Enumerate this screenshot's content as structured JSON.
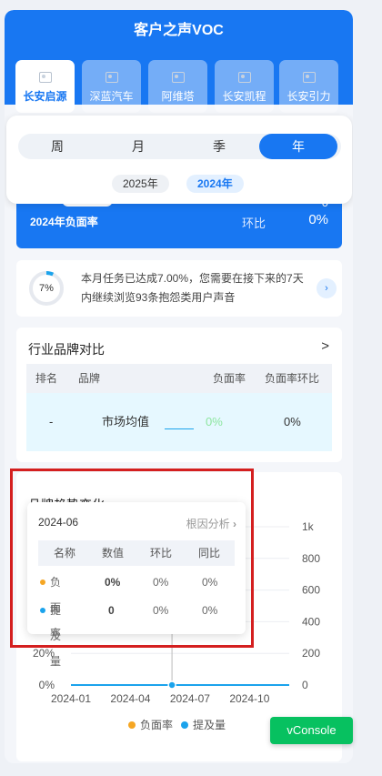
{
  "header": {
    "title": "客户之声VOC"
  },
  "brands": [
    {
      "label": "长安启源",
      "active": true
    },
    {
      "label": "深蓝汽车",
      "active": false
    },
    {
      "label": "阿维塔",
      "active": false
    },
    {
      "label": "长安凯程",
      "active": false
    },
    {
      "label": "长安引力",
      "active": false
    }
  ],
  "periods": [
    {
      "label": "周",
      "active": false
    },
    {
      "label": "月",
      "active": false
    },
    {
      "label": "季",
      "active": false
    },
    {
      "label": "年",
      "active": true
    }
  ],
  "years": [
    {
      "label": "2025年",
      "active": false
    },
    {
      "label": "2024年",
      "active": true
    }
  ],
  "summary": {
    "year_label": "2024年负面率",
    "huanbi_label": "环比",
    "huanbi_value": "0%",
    "top_value": "0"
  },
  "task": {
    "percent_text": "7%",
    "percent_value": 0.07,
    "message": "本月任务已达成7.00%，您需要在接下来的7天内继续浏览93条抱怨类用户声音",
    "arrow": "›"
  },
  "comparison": {
    "title": "行业品牌对比",
    "chevron": ">",
    "headers": [
      "排名",
      "品牌",
      "负面率",
      "负面率环比"
    ],
    "row": {
      "rank": "-",
      "brand": "市场均值",
      "rate": "0%",
      "rate_change": "0%"
    }
  },
  "trend": {
    "title": "品牌趋势变化",
    "tooltip": {
      "date": "2024-06",
      "action": "根因分析",
      "headers": [
        "名称",
        "数值",
        "环比",
        "同比"
      ],
      "rows": [
        {
          "name": "负面率",
          "value": "0%",
          "huanbi": "0%",
          "tongbi": "0%",
          "color": "#f5a623"
        },
        {
          "name": "提及量",
          "value": "0",
          "huanbi": "0%",
          "tongbi": "0%",
          "color": "#1ba3ec"
        }
      ]
    },
    "legend": [
      {
        "name": "负面率",
        "color": "#f5a623"
      },
      {
        "name": "提及量",
        "color": "#1ba3ec"
      }
    ]
  },
  "chart_data": {
    "type": "line",
    "title": "品牌趋势变化",
    "x_ticks": [
      "2024-01",
      "2024-04",
      "2024-07",
      "2024-10"
    ],
    "y_left_ticks": [
      "0%",
      "20%"
    ],
    "y_right_ticks": [
      "0",
      "200",
      "400",
      "600",
      "800",
      "1k"
    ],
    "series": [
      {
        "name": "负面率",
        "values": [
          0,
          0,
          0,
          0,
          0,
          0,
          0,
          0,
          0,
          0,
          0,
          0
        ]
      },
      {
        "name": "提及量",
        "values": [
          0,
          0,
          0,
          0,
          0,
          0,
          0,
          0,
          0,
          0,
          0,
          0
        ]
      }
    ],
    "selected_point": "2024-06"
  },
  "vconsole": {
    "label": "vConsole"
  }
}
